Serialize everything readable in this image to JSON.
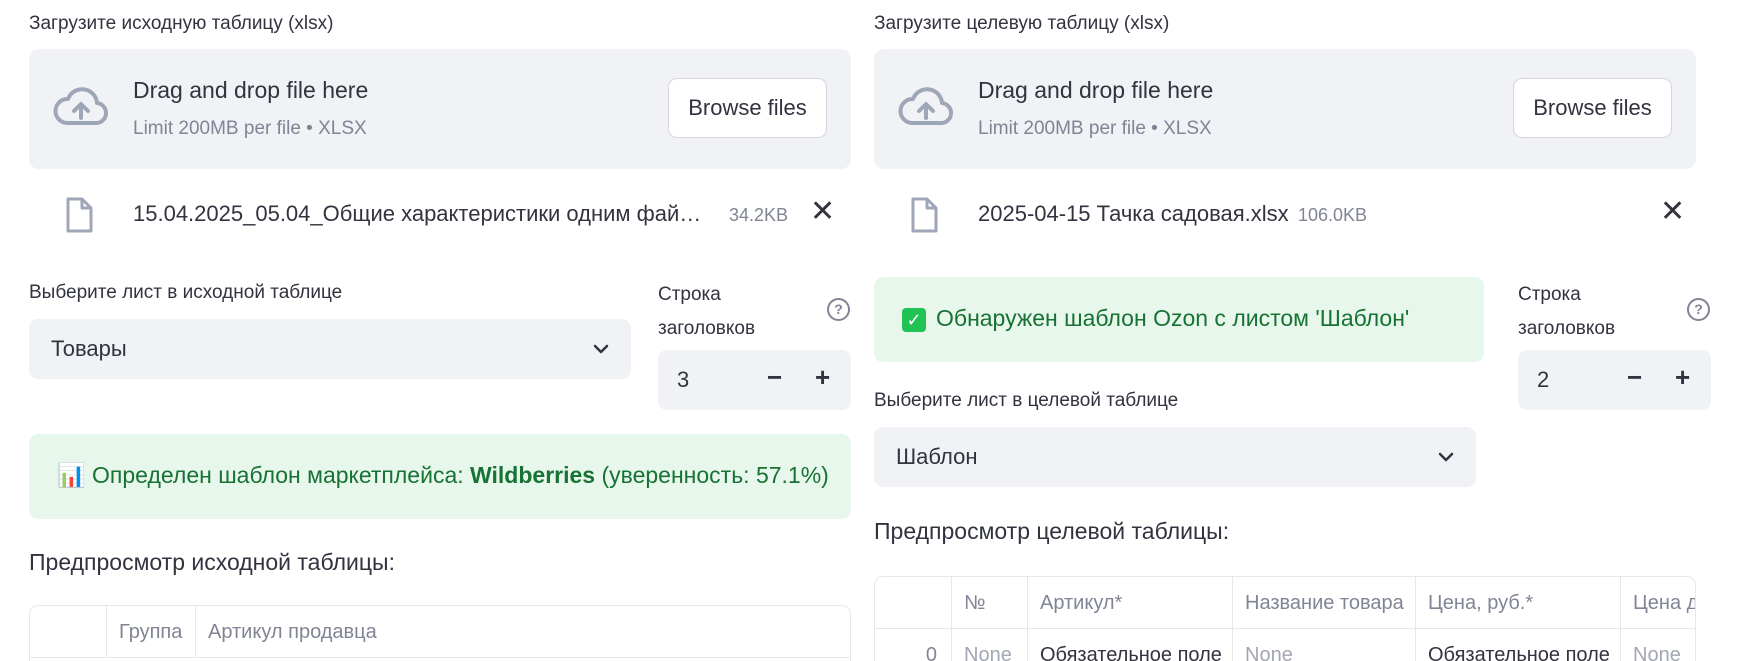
{
  "left": {
    "upload_label": "Загрузите исходную таблицу (xlsx)",
    "dropzone": {
      "title": "Drag and drop file here",
      "subtitle": "Limit 200MB per file • XLSX",
      "browse_label": "Browse files"
    },
    "file": {
      "name": "15.04.2025_05.04_Общие характеристики одним фай…",
      "size": "34.2KB",
      "close": "✕"
    },
    "sheet_label": "Выберите лист в исходной таблице",
    "sheet_value": "Товары",
    "header_row": {
      "label_line1": "Строка",
      "label_line2": "заголовков",
      "value": "3",
      "help": "?",
      "minus": "−",
      "plus": "+"
    },
    "alert": {
      "icon": "📊",
      "prefix": "Определен шаблон маркетплейса: ",
      "highlight": "Wildberries",
      "suffix": " (уверенность: 57.1%)"
    },
    "preview_title": "Предпросмотр исходной таблицы:",
    "table": {
      "headers": [
        "",
        "Группа",
        "Артикул продавца"
      ]
    }
  },
  "right": {
    "upload_label": "Загрузите целевую таблицу (xlsx)",
    "dropzone": {
      "title": "Drag and drop file here",
      "subtitle": "Limit 200MB per file • XLSX",
      "browse_label": "Browse files"
    },
    "file": {
      "name": "2025-04-15 Тачка садовая.xlsx",
      "size": "106.0KB",
      "close": "✕"
    },
    "alert": {
      "check": "✓",
      "text": "Обнаружен шаблон Ozon с листом 'Шаблон'"
    },
    "header_row": {
      "label_line1": "Строка",
      "label_line2": "заголовков",
      "value": "2",
      "help": "?",
      "minus": "−",
      "plus": "+"
    },
    "sheet_label": "Выберите лист в целевой таблице",
    "sheet_value": "Шаблон",
    "preview_title": "Предпросмотр целевой таблицы:",
    "table": {
      "headers": [
        "",
        "№",
        "Артикул*",
        "Название товара",
        "Цена, руб.*",
        "Цена до"
      ],
      "row0": [
        "0",
        "None",
        "Обязательное поле",
        "None",
        "Обязательное поле",
        "None"
      ]
    }
  },
  "colors": {
    "accent_green": "#177233",
    "success_bg": "#e7f7ec",
    "dropzone_bg": "#f0f2f6",
    "checkbox_green": "#21c354"
  }
}
